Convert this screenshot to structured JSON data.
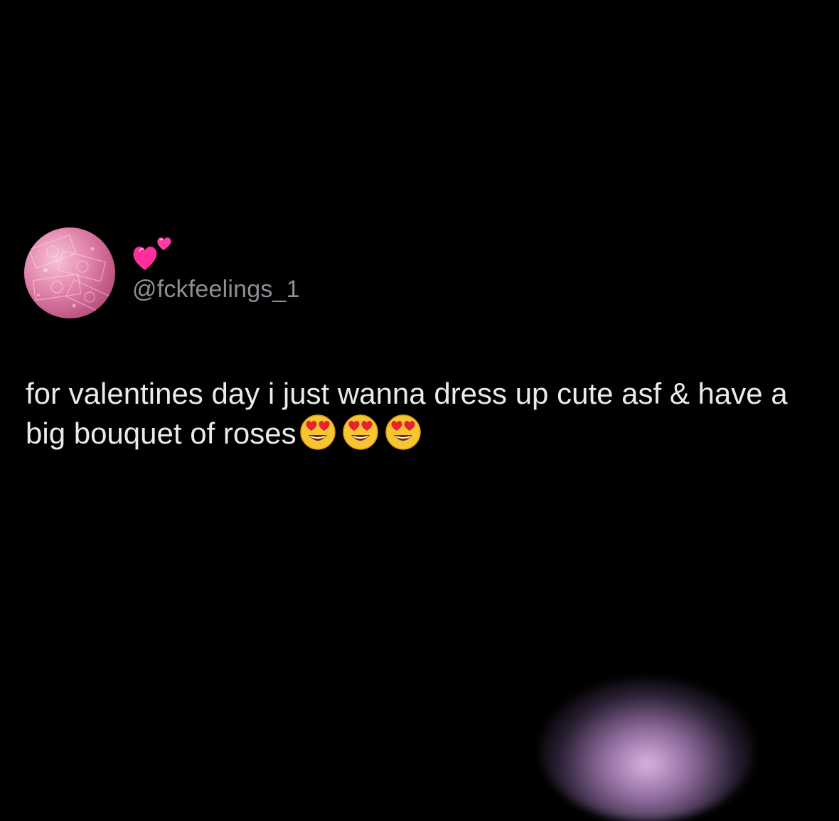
{
  "post": {
    "display_name_icon": "two-hearts-icon",
    "handle": "@fckfeelings_1",
    "text": "for valentines day i just wanna dress up cute asf & have a big bouquet of roses",
    "emojis": [
      "heart-eyes-emoji",
      "heart-eyes-emoji",
      "heart-eyes-emoji"
    ]
  },
  "colors": {
    "background": "#000000",
    "text": "#e9eaeb",
    "handle": "#8b9096",
    "accent_pink": "#ff3ea5"
  }
}
